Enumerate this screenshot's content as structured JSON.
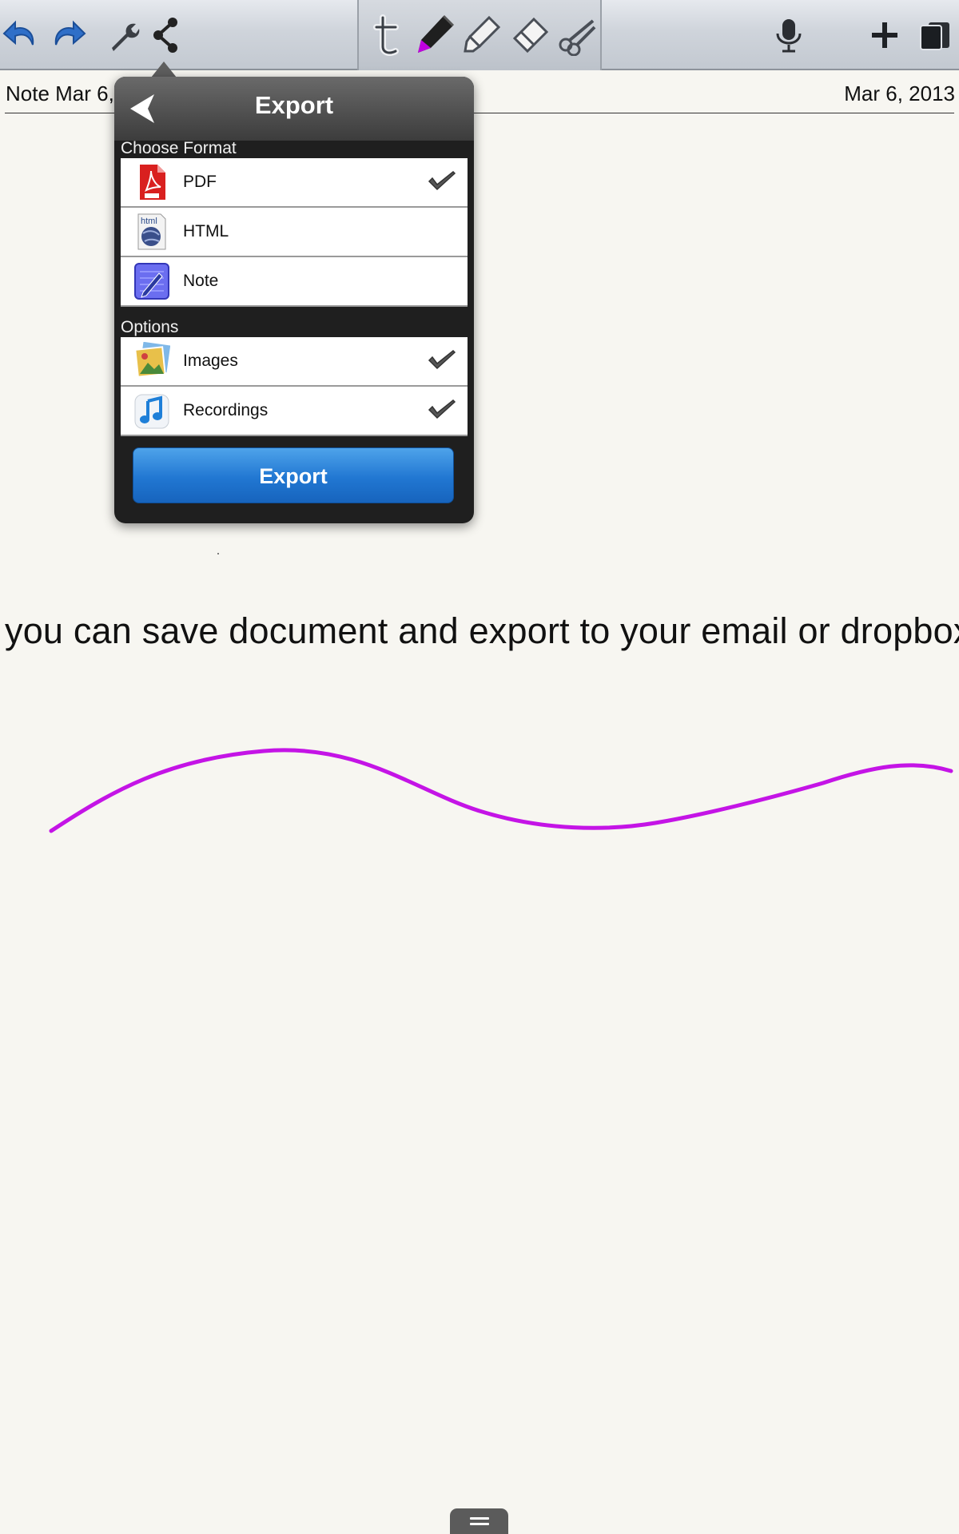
{
  "toolbar": {
    "left_icons": [
      "undo-icon",
      "redo-icon",
      "wrench-icon",
      "share-icon"
    ],
    "tool_icons": [
      "text-tool-icon",
      "pen-tool-icon",
      "highlighter-tool-icon",
      "eraser-tool-icon",
      "scissors-tool-icon"
    ],
    "right_icons": [
      "microphone-icon",
      "add-icon",
      "notebooks-icon"
    ],
    "accent_color": "#2f6fc8",
    "active_pen_color": "#c000e0"
  },
  "note": {
    "title": "Note Mar 6,",
    "date": "Mar 6, 2013",
    "body_text": "you can save document and export to your email or dropbox",
    "ink_color": "#c414e6"
  },
  "export_popover": {
    "title": "Export",
    "format_section": "Choose Format",
    "formats": [
      {
        "label": "PDF",
        "icon": "pdf-icon",
        "checked": true
      },
      {
        "label": "HTML",
        "icon": "html-globe-icon",
        "checked": false
      },
      {
        "label": "Note",
        "icon": "note-pencil-icon",
        "checked": false
      }
    ],
    "options_section": "Options",
    "options": [
      {
        "label": "Images",
        "icon": "images-icon",
        "checked": true
      },
      {
        "label": "Recordings",
        "icon": "music-note-icon",
        "checked": true
      }
    ],
    "export_button": "Export",
    "button_color": "#2177d2"
  }
}
